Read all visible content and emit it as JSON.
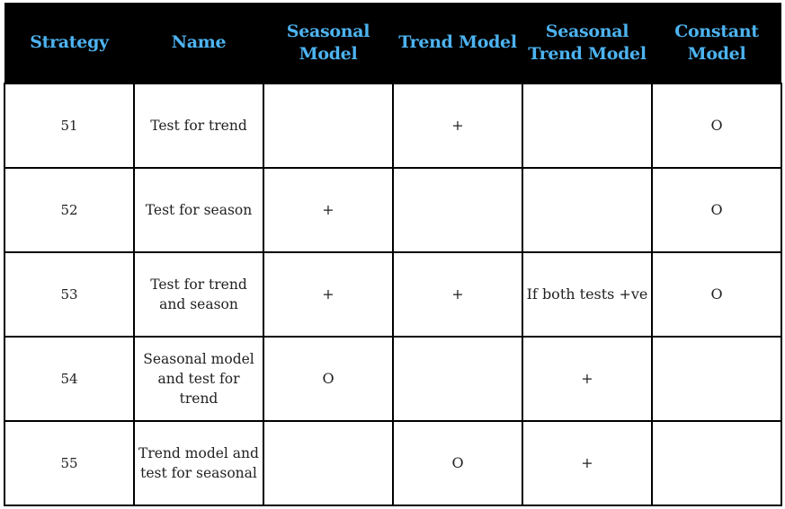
{
  "table": {
    "headers": [
      "Strategy",
      "Name",
      "Seasonal Model",
      "Trend Model",
      "Seasonal Trend Model",
      "Constant Model"
    ],
    "header_color": "#4db3f0",
    "header_background": "#000000",
    "rows": [
      {
        "strategy": "51",
        "name": "Test for trend",
        "seasonal": "",
        "trend": "+",
        "seasonal_trend": "",
        "constant": "O"
      },
      {
        "strategy": "52",
        "name": "Test for season",
        "seasonal": "+",
        "trend": "",
        "seasonal_trend": "",
        "constant": "O"
      },
      {
        "strategy": "53",
        "name": "Test for trend and season",
        "seasonal": "+",
        "trend": "+",
        "seasonal_trend": "If both tests +ve",
        "constant": "O"
      },
      {
        "strategy": "54",
        "name": "Seasonal model and test for trend",
        "seasonal": "O",
        "trend": "",
        "seasonal_trend": "+",
        "constant": ""
      },
      {
        "strategy": "55",
        "name": "Trend model and test for seasonal",
        "seasonal": "",
        "trend": "O",
        "seasonal_trend": "+",
        "constant": ""
      }
    ]
  }
}
